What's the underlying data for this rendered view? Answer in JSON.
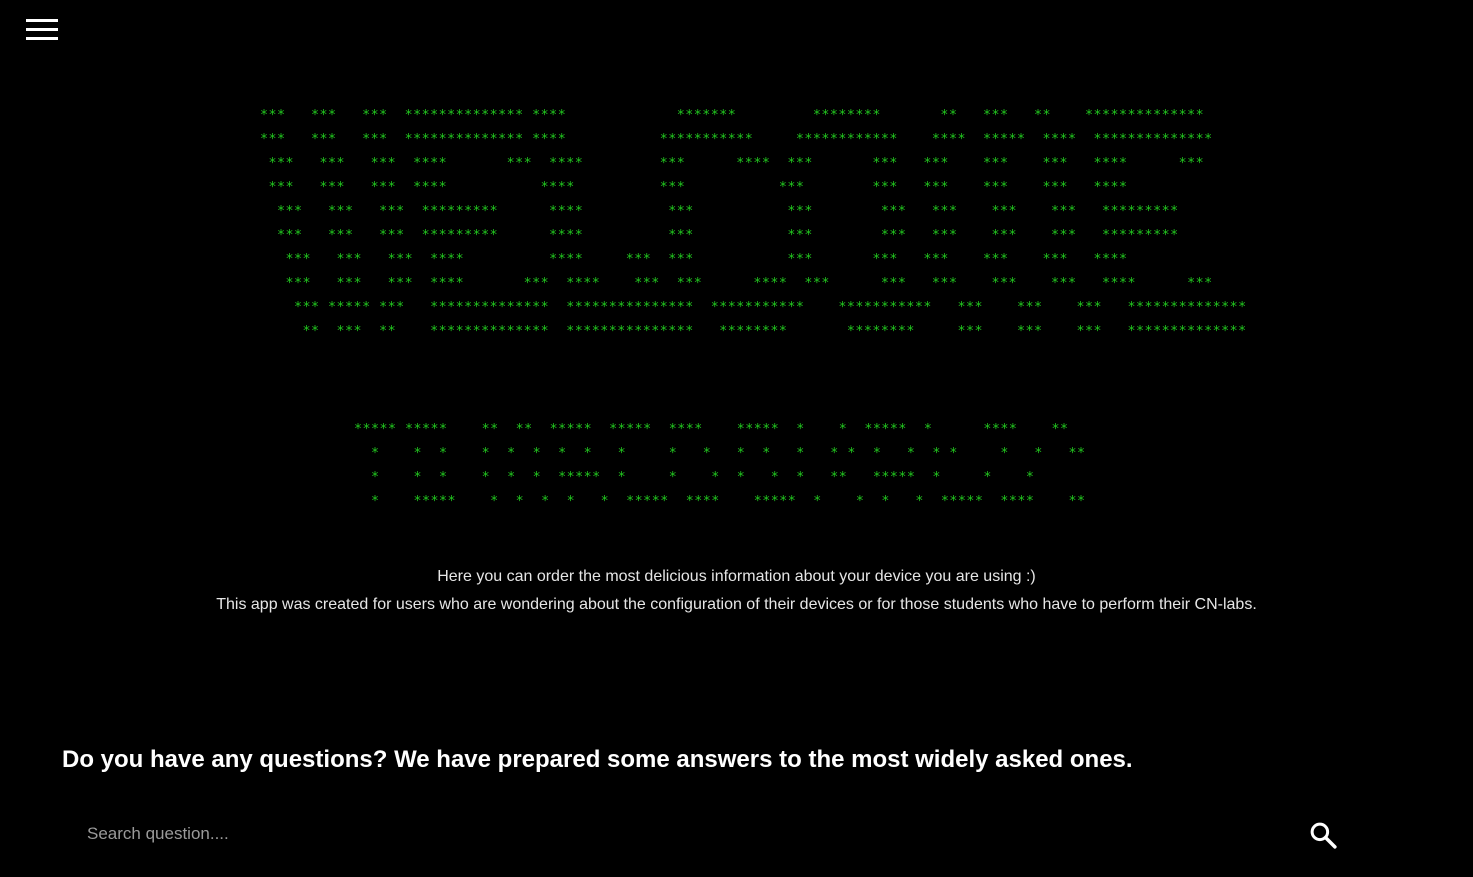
{
  "nav": {
    "menu_icon": "hamburger-menu-icon"
  },
  "banner": {
    "accent_color": "#22c91f",
    "title_art": [
      "***   ***   ***  ************** ****             *******         ********       **   ***   **    **************",
      "***   ***   ***  ************** ****           ***********     ************    ****  *****  ****  **************",
      " ***   ***   ***  ****       ***  ****         ***      ****  ***       ***   ***    ***    ***   ****      ***",
      " ***   ***   ***  ****           ****          ***           ***        ***   ***    ***    ***   ****",
      "  ***   ***   ***  *********      ****          ***           ***        ***   ***    ***    ***   *********",
      "  ***   ***   ***  *********      ****          ***           ***        ***   ***    ***    ***   *********",
      "   ***   ***   ***  ****          ****     ***  ***           ***       ***   ***    ***    ***   ****",
      "   ***   ***   ***  ****       ***  ****    ***  ***      ****  ***      ***   ***    ***    ***   ****      ***",
      "    *** ***** ***   **************  ***************  ***********    ***********   ***    ***    ***   **************",
      "     **  ***  **    **************  ***************   ********       ********     ***    ***    ***   **************"
    ],
    "subtitle_art": [
      "***** *****    **  **  *****  *****  ****    *****  *    *  *****  *      ****    **",
      "  *    *  *    *  *  *  *  *   *     *   *   *  *   *   * *  *   *  * *     *   *   **",
      "  *    *  *    *  *  *  *****  *     *    *  *   *  *   **   *****  *     *    *",
      "  *    *****    *  *  *  *   *  *****  ****    *****  *    *  *   *  *****  ****    **"
    ]
  },
  "intro": {
    "line1": "Here you can order the most delicious information about your device you are using :)",
    "line2": "This app was created for users who are wondering about the configuration of their devices or for those students who have to perform their CN-labs."
  },
  "faq": {
    "heading": "Do you have any questions? We have prepared some answers to the most widely asked ones.",
    "search_placeholder": "Search question....",
    "search_value": "",
    "search_icon": "search-icon"
  }
}
